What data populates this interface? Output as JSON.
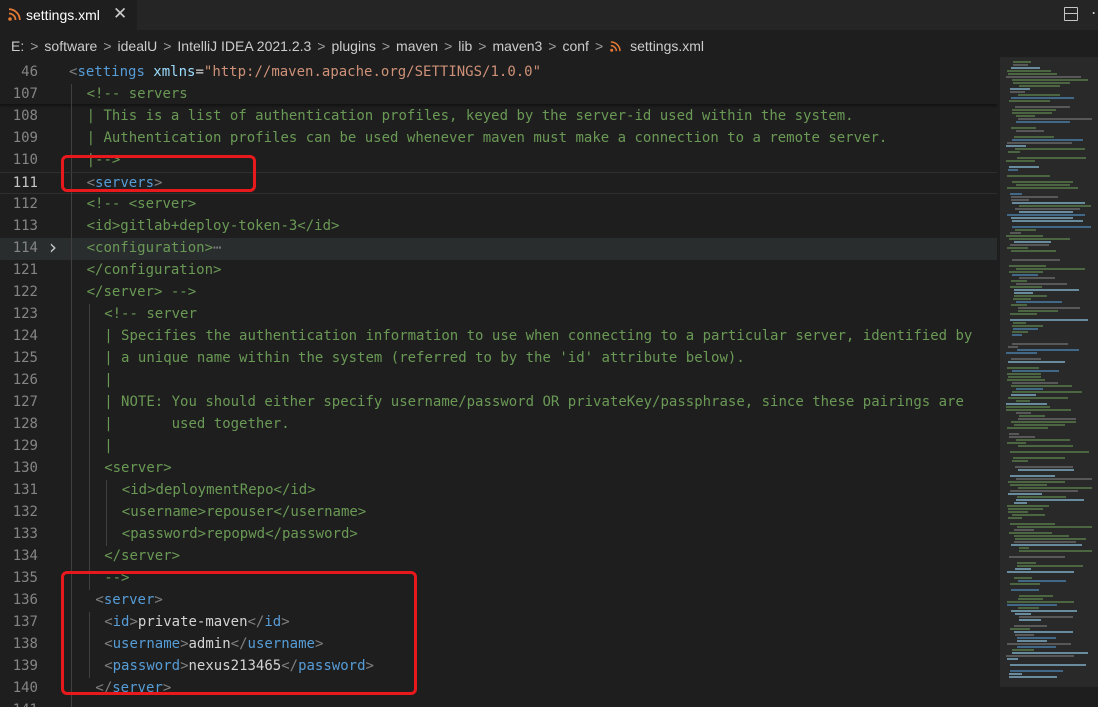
{
  "tab": {
    "title": "settings.xml",
    "close_glyph": "✕",
    "file_icon": "rss-xml-file-icon"
  },
  "window_actions": {
    "split_editor": "split-editor-icon",
    "more": "⋯"
  },
  "breadcrumb": {
    "items": [
      "E:",
      "software",
      "idealU",
      "IntelliJ IDEA 2021.2.3",
      "plugins",
      "maven",
      "lib",
      "maven3",
      "conf",
      "settings.xml"
    ],
    "separator": ">"
  },
  "editor": {
    "lines": [
      {
        "num": "46",
        "indent": 0,
        "tokens": [
          {
            "t": "<",
            "c": "punc"
          },
          {
            "t": "settings",
            "c": "tag"
          },
          {
            "t": " xmlns",
            "c": "attr"
          },
          {
            "t": "=",
            "c": "text"
          },
          {
            "t": "\"http://maven.apache.org/SETTINGS/1.0.0\"",
            "c": "str"
          }
        ]
      },
      {
        "num": "107",
        "indent": 1,
        "tokens": [
          {
            "t": "<!-- servers",
            "c": "com"
          }
        ]
      },
      {
        "num": "108",
        "indent": 1,
        "tokens": [
          {
            "t": "| This is a list of authentication profiles, keyed by the server-id used within the system.",
            "c": "com"
          }
        ]
      },
      {
        "num": "109",
        "indent": 1,
        "tokens": [
          {
            "t": "| Authentication profiles can be used whenever maven must make a connection to a remote server.",
            "c": "com"
          }
        ]
      },
      {
        "num": "110",
        "indent": 1,
        "tokens": [
          {
            "t": "|-->",
            "c": "com"
          }
        ]
      },
      {
        "num": "111",
        "indent": 1,
        "tokens": [
          {
            "t": "<",
            "c": "punc"
          },
          {
            "t": "servers",
            "c": "tag"
          },
          {
            "t": ">",
            "c": "punc"
          }
        ]
      },
      {
        "num": "112",
        "indent": 1,
        "tokens": [
          {
            "t": "<!-- <server>",
            "c": "com"
          }
        ]
      },
      {
        "num": "113",
        "indent": 1,
        "tokens": [
          {
            "t": "<id>gitlab+deploy-token-3</id>",
            "c": "com"
          }
        ]
      },
      {
        "num": "114",
        "indent": 1,
        "tokens": [
          {
            "t": "<configuration>",
            "c": "com"
          },
          {
            "t": "⋯",
            "c": "fold"
          }
        ]
      },
      {
        "num": "121",
        "indent": 1,
        "tokens": [
          {
            "t": "</configuration>",
            "c": "com"
          }
        ]
      },
      {
        "num": "122",
        "indent": 1,
        "tokens": [
          {
            "t": "</server> -->",
            "c": "com"
          }
        ]
      },
      {
        "num": "123",
        "indent": 2,
        "tokens": [
          {
            "t": "<!-- server",
            "c": "com"
          }
        ]
      },
      {
        "num": "124",
        "indent": 2,
        "tokens": [
          {
            "t": "| Specifies the authentication information to use when connecting to a particular server, identified by",
            "c": "com"
          }
        ]
      },
      {
        "num": "125",
        "indent": 2,
        "tokens": [
          {
            "t": "| a unique name within the system (referred to by the 'id' attribute below).",
            "c": "com"
          }
        ]
      },
      {
        "num": "126",
        "indent": 2,
        "tokens": [
          {
            "t": "|",
            "c": "com"
          }
        ]
      },
      {
        "num": "127",
        "indent": 2,
        "tokens": [
          {
            "t": "| NOTE: You should either specify username/password OR privateKey/passphrase, since these pairings are",
            "c": "com"
          }
        ]
      },
      {
        "num": "128",
        "indent": 2,
        "tokens": [
          {
            "t": "|       used together.",
            "c": "com"
          }
        ]
      },
      {
        "num": "129",
        "indent": 2,
        "tokens": [
          {
            "t": "|",
            "c": "com"
          }
        ]
      },
      {
        "num": "130",
        "indent": 2,
        "tokens": [
          {
            "t": "<server>",
            "c": "com"
          }
        ]
      },
      {
        "num": "131",
        "indent": 3,
        "tokens": [
          {
            "t": "<id>deploymentRepo</id>",
            "c": "com"
          }
        ]
      },
      {
        "num": "132",
        "indent": 3,
        "tokens": [
          {
            "t": "<username>repouser</username>",
            "c": "com"
          }
        ]
      },
      {
        "num": "133",
        "indent": 3,
        "tokens": [
          {
            "t": "<password>repopwd</password>",
            "c": "com"
          }
        ]
      },
      {
        "num": "134",
        "indent": 2,
        "tokens": [
          {
            "t": "</server>",
            "c": "com"
          }
        ]
      },
      {
        "num": "135",
        "indent": 2,
        "tokens": [
          {
            "t": "-->",
            "c": "com"
          }
        ]
      },
      {
        "num": "136",
        "indent": 1.5,
        "tokens": [
          {
            "t": "<",
            "c": "punc"
          },
          {
            "t": "server",
            "c": "tag"
          },
          {
            "t": ">",
            "c": "punc"
          }
        ]
      },
      {
        "num": "137",
        "indent": 2,
        "tokens": [
          {
            "t": "<",
            "c": "punc"
          },
          {
            "t": "id",
            "c": "tag"
          },
          {
            "t": ">",
            "c": "punc"
          },
          {
            "t": "private-maven",
            "c": "text"
          },
          {
            "t": "</",
            "c": "punc"
          },
          {
            "t": "id",
            "c": "tag"
          },
          {
            "t": ">",
            "c": "punc"
          }
        ]
      },
      {
        "num": "138",
        "indent": 2,
        "tokens": [
          {
            "t": "<",
            "c": "punc"
          },
          {
            "t": "username",
            "c": "tag"
          },
          {
            "t": ">",
            "c": "punc"
          },
          {
            "t": "admin",
            "c": "text"
          },
          {
            "t": "</",
            "c": "punc"
          },
          {
            "t": "username",
            "c": "tag"
          },
          {
            "t": ">",
            "c": "punc"
          }
        ]
      },
      {
        "num": "139",
        "indent": 2,
        "tokens": [
          {
            "t": "<",
            "c": "punc"
          },
          {
            "t": "password",
            "c": "tag"
          },
          {
            "t": ">",
            "c": "punc"
          },
          {
            "t": "nexus213465",
            "c": "text"
          },
          {
            "t": "</",
            "c": "punc"
          },
          {
            "t": "password",
            "c": "tag"
          },
          {
            "t": ">",
            "c": "punc"
          }
        ]
      },
      {
        "num": "140",
        "indent": 1.5,
        "tokens": [
          {
            "t": "</",
            "c": "punc"
          },
          {
            "t": "server",
            "c": "tag"
          },
          {
            "t": ">",
            "c": "punc"
          }
        ]
      },
      {
        "num": "141",
        "indent": 1,
        "tokens": []
      }
    ],
    "active_line": "111",
    "folded_line": "114"
  },
  "colors": {
    "background": "#1e1e1e",
    "tag": "#569cd6",
    "comment": "#6a9955",
    "string": "#ce9178",
    "attribute": "#9cdcfe",
    "annotation_red": "#e8191c"
  }
}
